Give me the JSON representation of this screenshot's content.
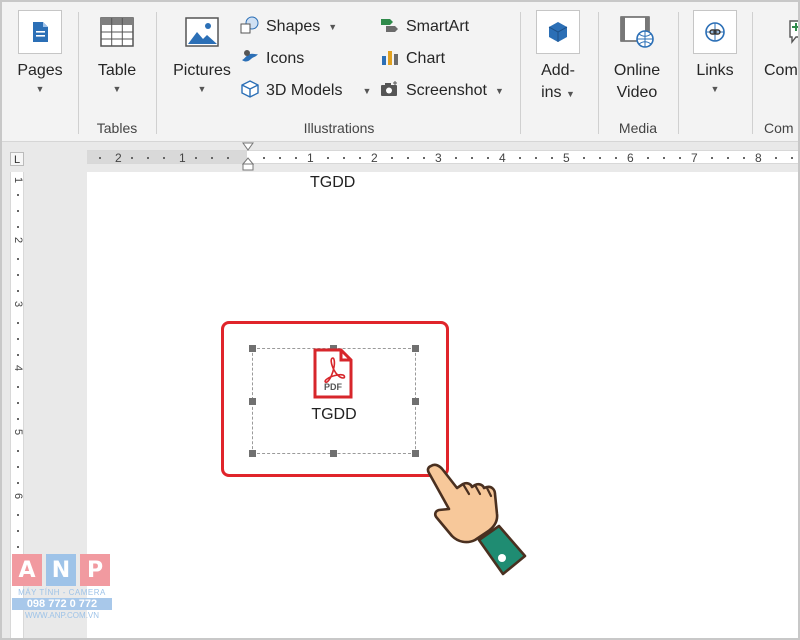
{
  "ribbon": {
    "pages": {
      "label": "Pages"
    },
    "table": {
      "label": "Table",
      "group": "Tables"
    },
    "illustrations": {
      "group": "Illustrations",
      "pictures": "Pictures",
      "shapes": "Shapes",
      "icons": "Icons",
      "models3d": "3D Models",
      "smartart": "SmartArt",
      "chart": "Chart",
      "screenshot": "Screenshot"
    },
    "addins": {
      "line1": "Add-",
      "line2": "ins"
    },
    "media": {
      "line1": "Online",
      "line2": "Video",
      "group": "Media"
    },
    "links": {
      "label": "Links"
    },
    "comments": {
      "label": "Com",
      "group": "Com"
    }
  },
  "ruler": {
    "horizontal": [
      "2",
      "1",
      "1",
      "2",
      "3",
      "4",
      "5",
      "6",
      "7",
      "8"
    ],
    "vertical": [
      "1",
      "1",
      "2",
      "3",
      "4",
      "5",
      "6",
      "7"
    ],
    "corner": "L"
  },
  "document": {
    "top_text": "TGDD",
    "object_label": "TGDD",
    "pdf_icon_text": "PDF"
  },
  "watermark": {
    "letters": [
      "A",
      "N",
      "P"
    ],
    "sub": "MÁY TÍNH - CAMERA",
    "phone": "098 772 0 772",
    "url": "WWW.ANP.COM.VN"
  },
  "colors": {
    "highlight": "#e0242a",
    "pdf_red": "#d7262b",
    "icon_blue": "#2b6fb6"
  }
}
